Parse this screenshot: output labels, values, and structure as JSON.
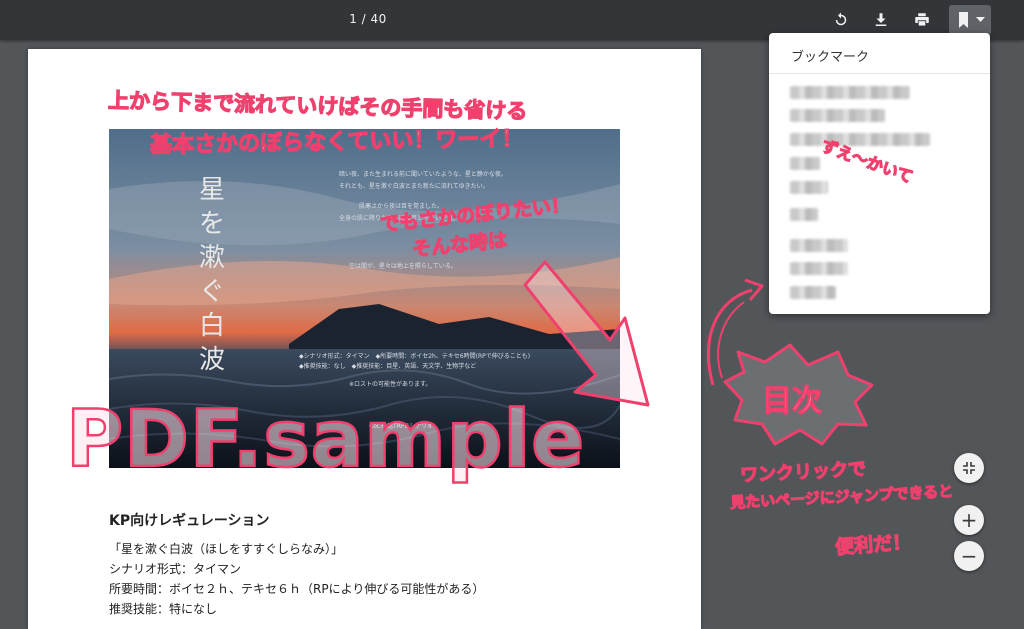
{
  "toolbar": {
    "page_indicator": "1 / 40",
    "icons": [
      "rotate-icon",
      "download-icon",
      "print-icon",
      "bookmark-icon",
      "chevron-down-icon"
    ]
  },
  "bookmark_panel": {
    "title": "ブックマーク",
    "items_blurred": true
  },
  "document": {
    "cover_title": "星を漱ぐ白波",
    "cover_credit": "CoC神話TRPGシナリオ",
    "cover_lines": [
      "暗い夜、また生まれる前に聞いていたような、星と静かな夜。",
      "それとも、星を漱ぐ白波とまた新たに流れてゆきたい。",
      "肌寒さから夜は目を覚ました。",
      "全身の肌に降りかかる雨の音と冷たい空気。",
      "空は闇が、星々は地上を照らしている。",
      "◆シナリオ形式：タイマン　◆所要時間：ボイセ2h、テキセ6時間(RPで伸びることも)",
      "◆推奨技能：なし　◆推奨技能：目星、英語、天文学、生物学など",
      "※ロストの可能性があります。",
      "CoC神話TRPGシナリオ"
    ],
    "regulation": {
      "heading": "KP向けレギュレーション",
      "lines": [
        "「星を漱ぐ白波（ほしをすすぐしらなみ）」",
        "シナリオ形式：タイマン",
        "所要時間：ボイセ２ｈ、テキセ６ｈ（RPにより伸びる可能性がある）",
        "推奨技能：特になし"
      ]
    }
  },
  "zoom": {
    "fit_icon": "fit-to-page-icon",
    "in_label": "+",
    "out_label": "−"
  },
  "annotations": {
    "top_line1": "上から下まで流れていけばその手間も省ける",
    "top_line2": "基本さかのぼらなくていい！ワーイ！",
    "middle_line1": "でもさかのぼりたい！",
    "middle_line2": "そんな時は",
    "side_note": "ずえ～かいて",
    "toc_label": "目次",
    "bottom_line1": "ワンクリックで",
    "bottom_line2": "見たいページにジャンプできると",
    "bottom_line3": "便利だ！",
    "watermark": "PDF.sample"
  },
  "colors": {
    "toolbar_bg": "#323639",
    "viewer_bg": "#525659",
    "annotation_stroke": "#f0406d",
    "annotation_fill": "#ffe3ec"
  }
}
